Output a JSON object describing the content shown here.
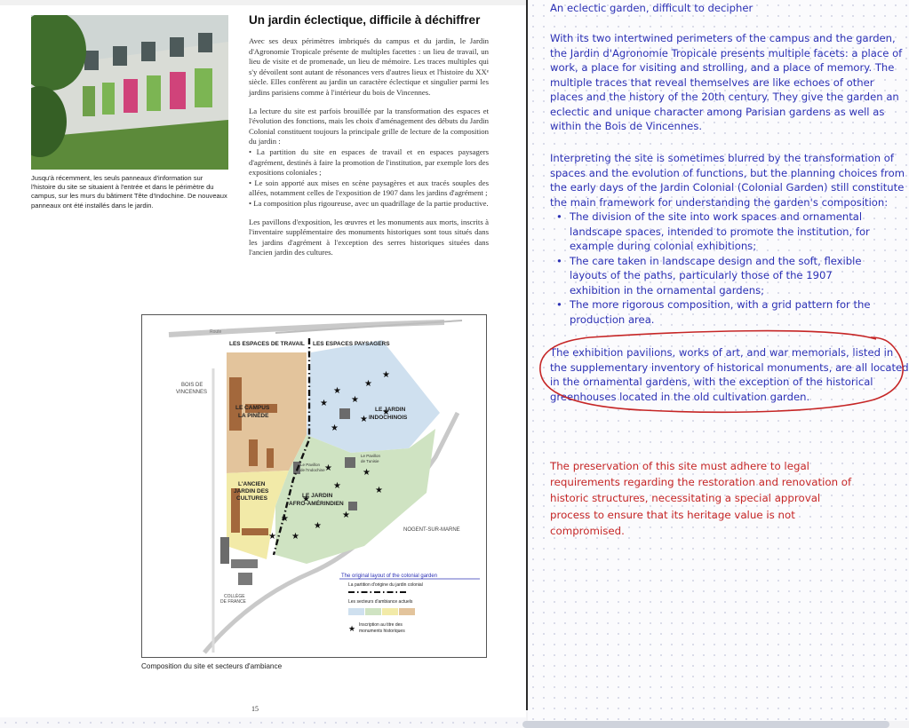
{
  "left_page": {
    "caption": "Jusqu'à récemment, les seuls panneaux d'information sur l'histoire du site se situaient à l'entrée et dans le périmètre du campus, sur les murs du bâtiment Tête d'Indochine. De nouveaux panneaux ont été installés dans le jardin.",
    "title": "Un jardin éclectique, difficile à déchiffrer",
    "para1": "Avec ses deux périmètres imbriqués du campus et du jardin, le Jardin d'Agronomie Tropicale présente de multiples facettes : un lieu de travail, un lieu de visite et de promenade, un lieu de mémoire. Les traces multiples qui s'y dévoilent sont autant de résonances vers d'autres lieux et l'histoire du XXᵉ siècle. Elles confèrent au jardin un caractère éclectique et singulier parmi les jardins parisiens comme à l'intérieur du bois de Vincennes.",
    "para2": "La lecture du site est parfois brouillée par la transformation des espaces et l'évolution des fonctions, mais les choix d'aménagement des débuts du Jardin Colonial constituent toujours la principale grille de lecture de la composition du jardin :",
    "bullets": [
      "• La partition du site en espaces de travail et en espaces paysagers d'agrément, destinés à faire la promotion de l'institution, par exemple lors des expositions coloniales ;",
      "• Le soin apporté aux mises en scène paysagères et aux tracés souples des allées, notamment celles de l'exposition de 1907 dans les jardins d'agrément ;",
      "• La composition plus rigoureuse, avec un quadrillage de la partie productive."
    ],
    "para3": "Les pavillons d'exposition, les œuvres et les monuments aux morts, inscrits à l'inventaire supplémentaire des monuments historiques sont tous situés dans les jardins d'agrément à l'exception des serres historiques situées dans l'ancien jardin des cultures.",
    "map_caption": "Composition du site et secteurs d'ambiance",
    "page_number": "15"
  },
  "map": {
    "top_label_work": "LES ESPACES DE TRAVAIL",
    "top_label_landscape": "LES ESPACES PAYSAGERS",
    "bois_line1": "BOIS DE",
    "bois_line2": "VINCENNES",
    "campus_line1": "LE CAMPUS",
    "campus_line2": "LA PINÈDE",
    "indo_line1": "LE JARDIN",
    "indo_line2": "INDOCHINOIS",
    "ancien_line1": "L'ANCIEN",
    "ancien_line2": "JARDIN DES",
    "ancien_line3": "CULTURES",
    "afro_line1": "LE JARDIN",
    "afro_line2": "AFRO-AMÉRINDIEN",
    "nogent": "NOGENT-SUR-MARNE",
    "college_line1": "COLLÈGE",
    "college_line2": "DE FRANCE",
    "pav_tunisie_line1": "Le Pavillon",
    "pav_tunisie_line2": "de Tunisie",
    "pav_indo_line1": "Le Pavillon",
    "pav_indo_line2": "de l'Indochine",
    "pav_small_line1": "Le Pavillon",
    "pav_small_line2": "de l'Indochine",
    "route_label": "Route",
    "legend_annotation": "The original layout of the colonial garden",
    "legend_partition": "La partition d'origine du jardin colonial",
    "legend_sectors": "Les secteurs d'ambiance actuels",
    "legend_monuments_line1": "Inscription au titre des",
    "legend_monuments_line2": "monuments historiques",
    "colors": {
      "work": "#e3c49c",
      "work_dark": "#a3683c",
      "landscape_blue": "#cfe0ef",
      "landscape_green": "#cfe3c2",
      "cultures_yellow": "#f2eaa8",
      "annotation_blue": "#2b30b5"
    }
  },
  "right_pane": {
    "title": "An eclectic garden, difficult to decipher",
    "para1": "With its two intertwined perimeters of the campus and the garden, the Jardin d'Agronomie Tropicale presents multiple facets: a place of work, a place for visiting and strolling, and a place of memory. The multiple traces that reveal themselves are like echoes of other places and the history of the 20th century. They give the garden an eclectic and unique character among Parisian gardens as well as within the Bois de Vincennes.",
    "para2": "Interpreting the site is sometimes blurred by the transformation of spaces and the evolution of functions, but the planning choices from the early days of the Jardin Colonial (Colonial Garden) still constitute the main framework for understanding the garden's composition:",
    "bullets": [
      "The division of the site into work spaces and ornamental landscape spaces, intended to promote the institution, for example during colonial exhibitions;",
      "The care taken in landscape design and the soft, flexible layouts of the paths, particularly those of the 1907 exhibition in the ornamental gardens;",
      "The more rigorous composition, with a grid pattern for the production area."
    ],
    "para3": "The exhibition pavilions, works of art, and war memorials, listed in the supplementary inventory of historical monuments, are all located in the ornamental gardens, with the exception of the historical greenhouses located in the old cultivation garden.",
    "red_lines": [
      "The preservation of this site must adhere to legal",
      "requirements regarding the restoration and renovation of",
      "historic structures, necessitating a special approval",
      "process to ensure that its heritage value is not",
      "compromised."
    ],
    "colors": {
      "text": "#2b30b5",
      "annotation": "#c62626"
    }
  }
}
